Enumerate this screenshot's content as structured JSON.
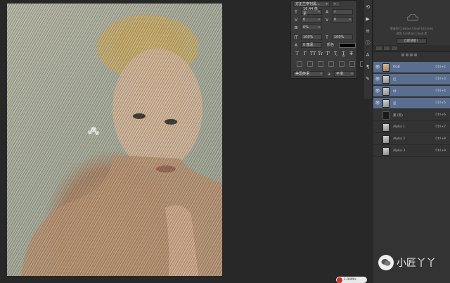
{
  "character_panel": {
    "font_family": "方正兰亭刊黑...",
    "font_size": "16.44 像素",
    "kerning_value": "0",
    "leading_value": "0",
    "tracking_value": "0%",
    "vertical_scale": "100%",
    "horizontal_scale": "100%",
    "baseline_shift": "0 像素",
    "color_label": "颜色",
    "type_style_buttons": [
      "T",
      "T",
      "TT",
      "Tr",
      "T'",
      "T,",
      "T",
      "T"
    ],
    "language": "美国英语",
    "antialias": "a",
    "antialias_mode": "平滑"
  },
  "libraries_panel": {
    "line1": "登录到 Creative Cloud Libraries",
    "line2": "启用 Creative Cloud 库",
    "button_label": "立即获取！"
  },
  "channels_panel": {
    "channels": [
      {
        "name": "RGB",
        "shortcut": "Ctrl+2",
        "visible": true,
        "selected": true
      },
      {
        "name": "红",
        "shortcut": "Ctrl+3",
        "visible": true,
        "selected": true
      },
      {
        "name": "绿",
        "shortcut": "Ctrl+4",
        "visible": true,
        "selected": true
      },
      {
        "name": "蓝",
        "shortcut": "Ctrl+5",
        "visible": true,
        "selected": true
      },
      {
        "name": "蒙 (黑)",
        "shortcut": "Ctrl+6",
        "visible": false,
        "selected": false
      },
      {
        "name": "Alpha 1",
        "shortcut": "Ctrl+7",
        "visible": false,
        "selected": false
      },
      {
        "name": "Alpha 2",
        "shortcut": "Ctrl+8",
        "visible": false,
        "selected": false
      },
      {
        "name": "Alpha 3",
        "shortcut": "Ctrl+9",
        "visible": false,
        "selected": false
      }
    ]
  },
  "status": {
    "zoom_badge": "1.04M/s"
  },
  "watermark": {
    "text": "小匠丫丫"
  },
  "colors": {
    "selection": "#5a6f90",
    "panel": "#333333",
    "background": "#282828"
  }
}
